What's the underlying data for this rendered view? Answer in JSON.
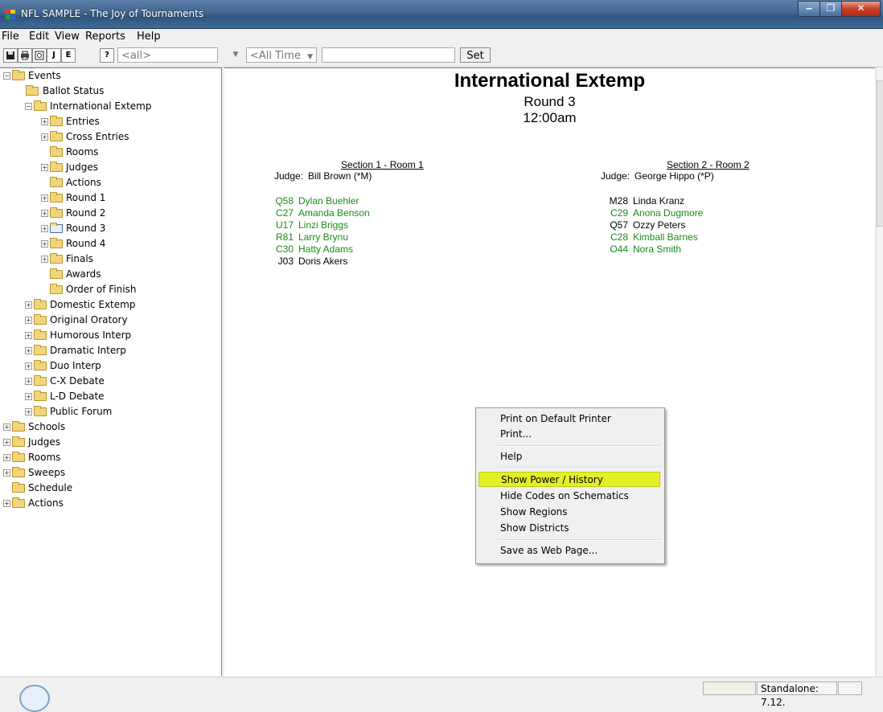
{
  "window": {
    "title": "NFL SAMPLE - The Joy of Tournaments",
    "minimize_glyph": "‒",
    "maximize_glyph": "❐",
    "close_glyph": "✕"
  },
  "menu": [
    "File",
    "Edit",
    "View",
    "Reports",
    "Help"
  ],
  "toolbar": {
    "j_label": "J",
    "e_label": "E",
    "help_glyph": "?",
    "filter_value": "<all>",
    "time_value": "<All Time",
    "search_value": "",
    "set_label": "Set"
  },
  "tree": {
    "events": "Events",
    "ballot_status": "Ballot Status",
    "international_extemp": "International Extemp",
    "entries": "Entries",
    "cross_entries": "Cross Entries",
    "rooms": "Rooms",
    "judges": "Judges",
    "actions": "Actions",
    "round1": "Round 1",
    "round2": "Round 2",
    "round3": "Round 3",
    "round4": "Round 4",
    "finals": "Finals",
    "awards": "Awards",
    "order_of_finish": "Order of Finish",
    "domestic_extemp": "Domestic Extemp",
    "original_oratory": "Original Oratory",
    "humorous_interp": "Humorous Interp",
    "dramatic_interp": "Dramatic Interp",
    "duo_interp": "Duo Interp",
    "cx_debate": "C-X Debate",
    "ld_debate": "L-D Debate",
    "public_forum": "Public Forum",
    "schools": "Schools",
    "top_judges": "Judges",
    "top_rooms": "Rooms",
    "sweeps": "Sweeps",
    "schedule": "Schedule",
    "top_actions": "Actions"
  },
  "doc": {
    "event_title": "International Extemp",
    "round": "Round 3",
    "time": "12:00am",
    "judge_label": "Judge:",
    "section1": {
      "heading": "Section 1 - Room 1",
      "judge": "Bill Brown (*M)",
      "entries": [
        {
          "code": "Q58",
          "name": "Dylan Buehler"
        },
        {
          "code": "C27",
          "name": "Amanda Benson"
        },
        {
          "code": "U17",
          "name": "Linzi Briggs"
        },
        {
          "code": "R81",
          "name": "Larry Brynu"
        },
        {
          "code": "C30",
          "name": "Hatty Adams"
        },
        {
          "code": "J03",
          "name": "Doris Akers"
        }
      ]
    },
    "section2": {
      "heading": "Section 2 - Room 2",
      "judge": "George Hippo (*P)",
      "entries": [
        {
          "code": "M28",
          "name": "Linda Kranz"
        },
        {
          "code": "C29",
          "name": "Anona Dugmore"
        },
        {
          "code": "Q57",
          "name": "Ozzy Peters"
        },
        {
          "code": "C28",
          "name": "Kimball Barnes"
        },
        {
          "code": "O44",
          "name": "Nora Smith"
        }
      ]
    }
  },
  "context_menu": {
    "print_default": "Print on Default Printer",
    "print": "Print...",
    "help": "Help",
    "show_power": "Show Power / History",
    "hide_codes": "Hide Codes on Schematics",
    "show_regions": "Show Regions",
    "show_districts": "Show Districts",
    "save_web": "Save as Web Page..."
  },
  "status": {
    "version": "Standalone: 7.12."
  },
  "colors": {
    "titlebar": "#3f6a97",
    "entry_green": "#1b8a1b",
    "highlight": "#e4f025"
  }
}
